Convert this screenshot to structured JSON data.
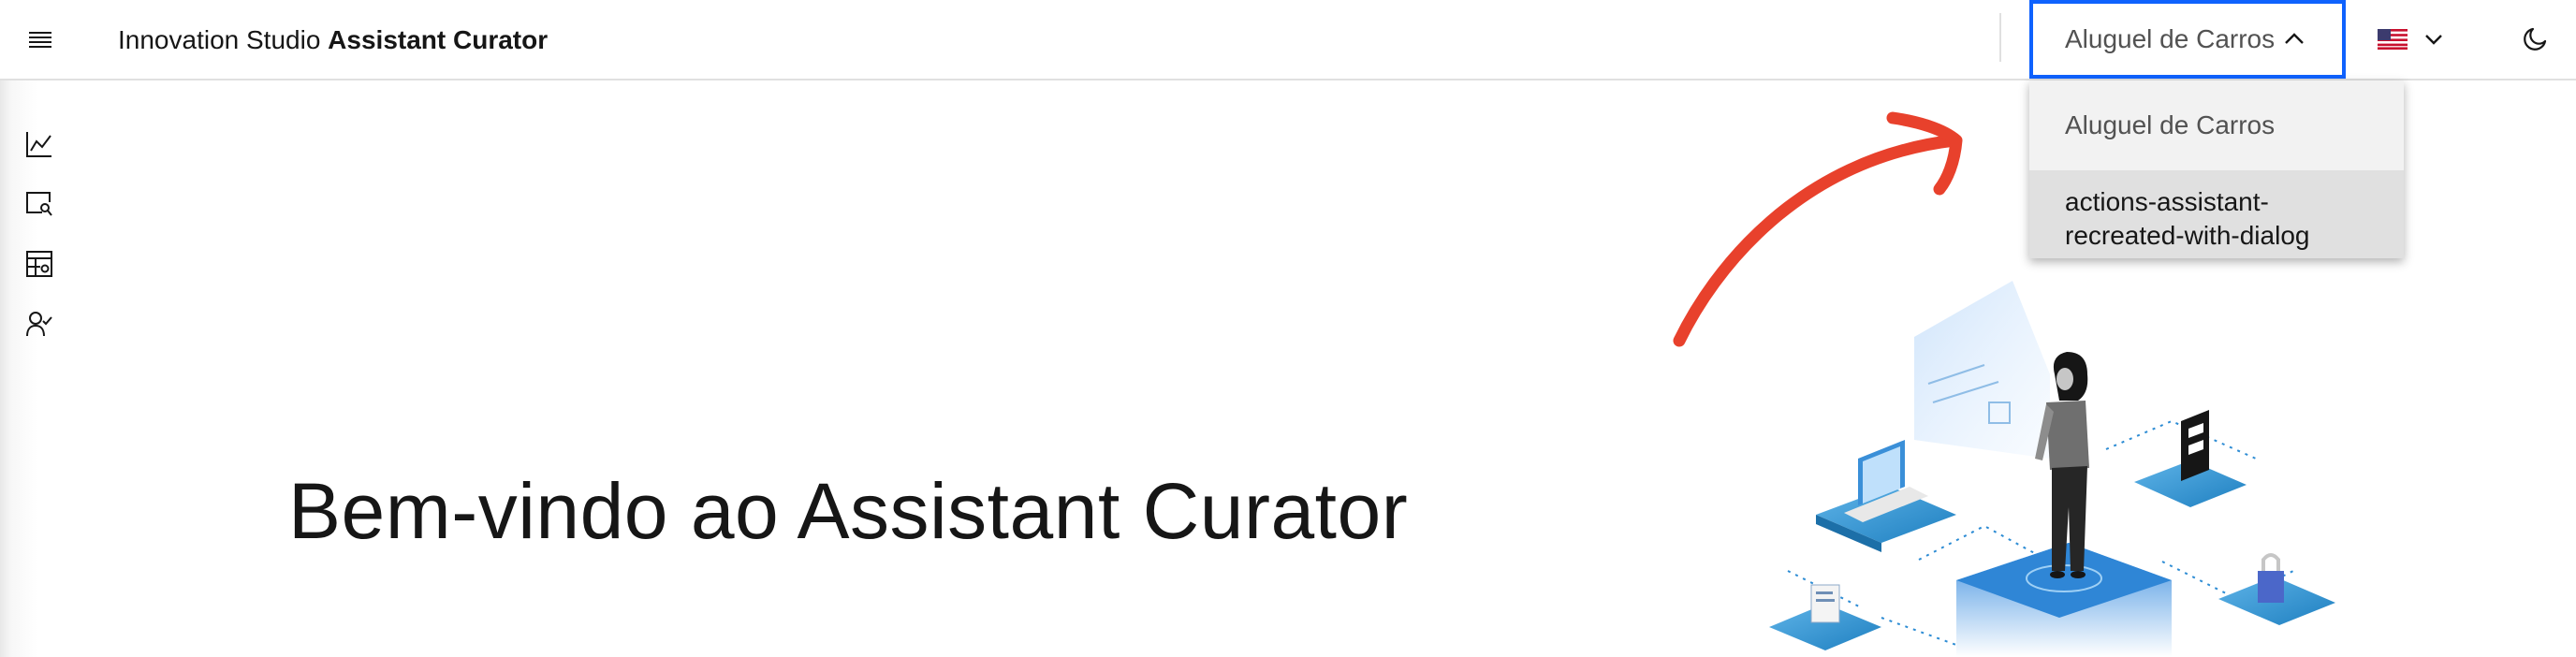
{
  "header": {
    "brand_prefix": "Innovation Studio",
    "brand_name": "Assistant Curator",
    "menu_icon": "hamburger-menu-icon",
    "selected_assistant": "Aluguel de Carros",
    "language_flag": "us-flag-icon",
    "theme_icon": "moon-icon"
  },
  "sidenav": {
    "items": [
      {
        "icon": "line-chart-icon"
      },
      {
        "icon": "search-document-icon"
      },
      {
        "icon": "data-table-icon"
      },
      {
        "icon": "user-check-icon"
      }
    ]
  },
  "dropdown": {
    "options": [
      {
        "label": "Aluguel de Carros"
      },
      {
        "label_line1": "actions-assistant-",
        "label_line2": "recreated-with-dialog"
      }
    ]
  },
  "main": {
    "welcome_title": "Bem-vindo ao Assistant Curator"
  },
  "colors": {
    "accent": "#0f62fe",
    "arrow": "#e8412c",
    "text": "#161616",
    "muted_text": "#525252"
  }
}
